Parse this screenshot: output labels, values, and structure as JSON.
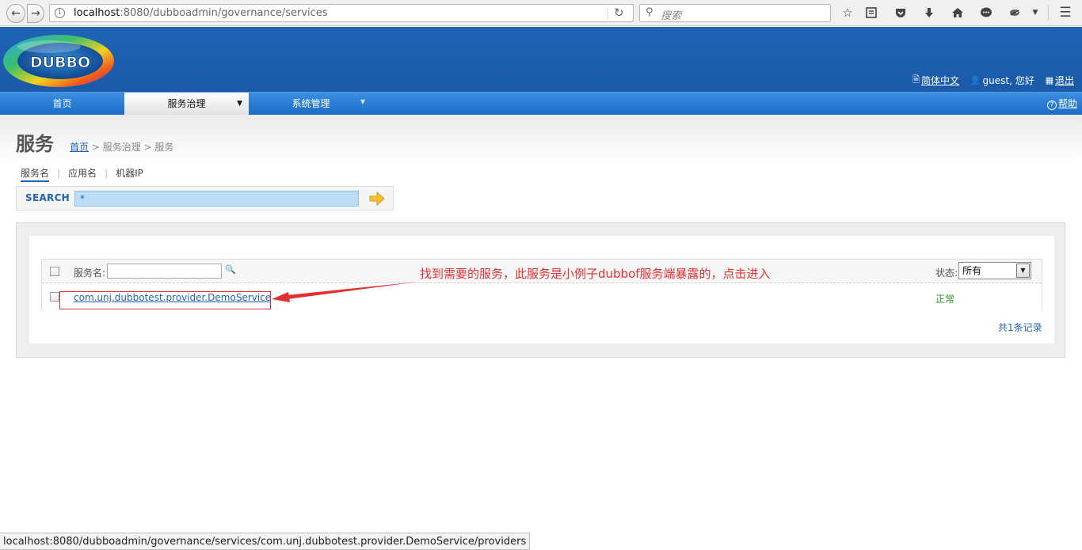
{
  "browser": {
    "url_host": "localhost",
    "url_path": ":8080/dubboadmin/governance/services",
    "search_placeholder": "搜索",
    "status_url": "localhost:8080/dubboadmin/governance/services/com.unj.dubbotest.provider.DemoService/providers"
  },
  "header": {
    "logo_text": "DUBBO",
    "language": "简体中文",
    "greeting": "guest, 您好",
    "logout": "退出"
  },
  "nav": {
    "home": "首页",
    "governance": "服务治理",
    "system": "系统管理",
    "help": "帮助"
  },
  "page": {
    "title": "服务",
    "breadcrumb_home": "首页",
    "breadcrumb_rest": " > 服务治理 > 服务"
  },
  "tabs": [
    "服务名",
    "应用名",
    "机器IP"
  ],
  "search": {
    "label": "SEARCH",
    "value": "*"
  },
  "table": {
    "filter_label": "服务名:",
    "status_label": "状态:",
    "status_selected": "所有",
    "rows": [
      {
        "service": "com.unj.dubbotest.provider.DemoService",
        "status": "正常"
      }
    ],
    "total": "共1条记录"
  },
  "annotation": "找到需要的服务，此服务是小例子dubbof服务端暴露的，点击进入",
  "colors": {
    "brand_blue": "#1f64b4",
    "annotation_red": "#e03030",
    "status_green": "#2a9a2a"
  }
}
